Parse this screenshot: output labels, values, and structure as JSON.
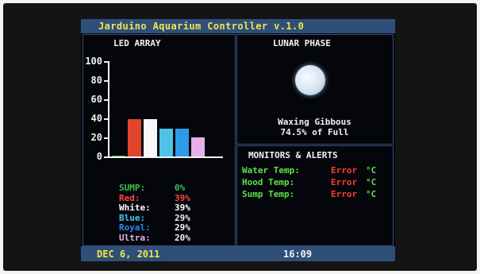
{
  "header": {
    "title": "Jarduino Aquarium Controller v.1.0"
  },
  "led_panel": {
    "title": "LED ARRAY",
    "y_ticks": [
      "100",
      "80",
      "60",
      "40",
      "20",
      "0"
    ],
    "channels": [
      {
        "label": "SUMP:",
        "value": "0%",
        "color": "#34c24a"
      },
      {
        "label": "Red:",
        "value": "39%",
        "color": "#ff4b3a"
      },
      {
        "label": "White:",
        "value": "39%",
        "color": "#ffffff"
      },
      {
        "label": "Blue:",
        "value": "29%",
        "color": "#45c9ec"
      },
      {
        "label": "Royal:",
        "value": "29%",
        "color": "#2a8cf0"
      },
      {
        "label": "Ultra:",
        "value": "20%",
        "color": "#e9b4ef"
      }
    ]
  },
  "chart_data": {
    "type": "bar",
    "title": "LED ARRAY",
    "categories": [
      "SUMP",
      "Red",
      "White",
      "Blue",
      "Royal",
      "Ultra"
    ],
    "values": [
      1,
      39,
      39,
      29,
      29,
      20
    ],
    "colors": [
      "#34c24a",
      "#e0452c",
      "#f7f7f7",
      "#4ec3e8",
      "#2f9ae8",
      "#e6b0ec"
    ],
    "ylim": [
      0,
      100
    ],
    "yticks": [
      0,
      20,
      40,
      60,
      80,
      100
    ]
  },
  "lunar": {
    "title": "LUNAR PHASE",
    "phase_name": "Waxing Gibbous",
    "percent_text": "74.5% of Full"
  },
  "monitors": {
    "title": "MONITORS & ALERTS",
    "rows": [
      {
        "label": "Water Temp:",
        "value": "Error",
        "unit": "°C"
      },
      {
        "label": "Hood Temp:",
        "value": "Error",
        "unit": "°C"
      },
      {
        "label": "Sump Temp:",
        "value": "Error",
        "unit": "°C"
      }
    ]
  },
  "footer": {
    "date": "DEC 6, 2011",
    "time": "16:09"
  }
}
